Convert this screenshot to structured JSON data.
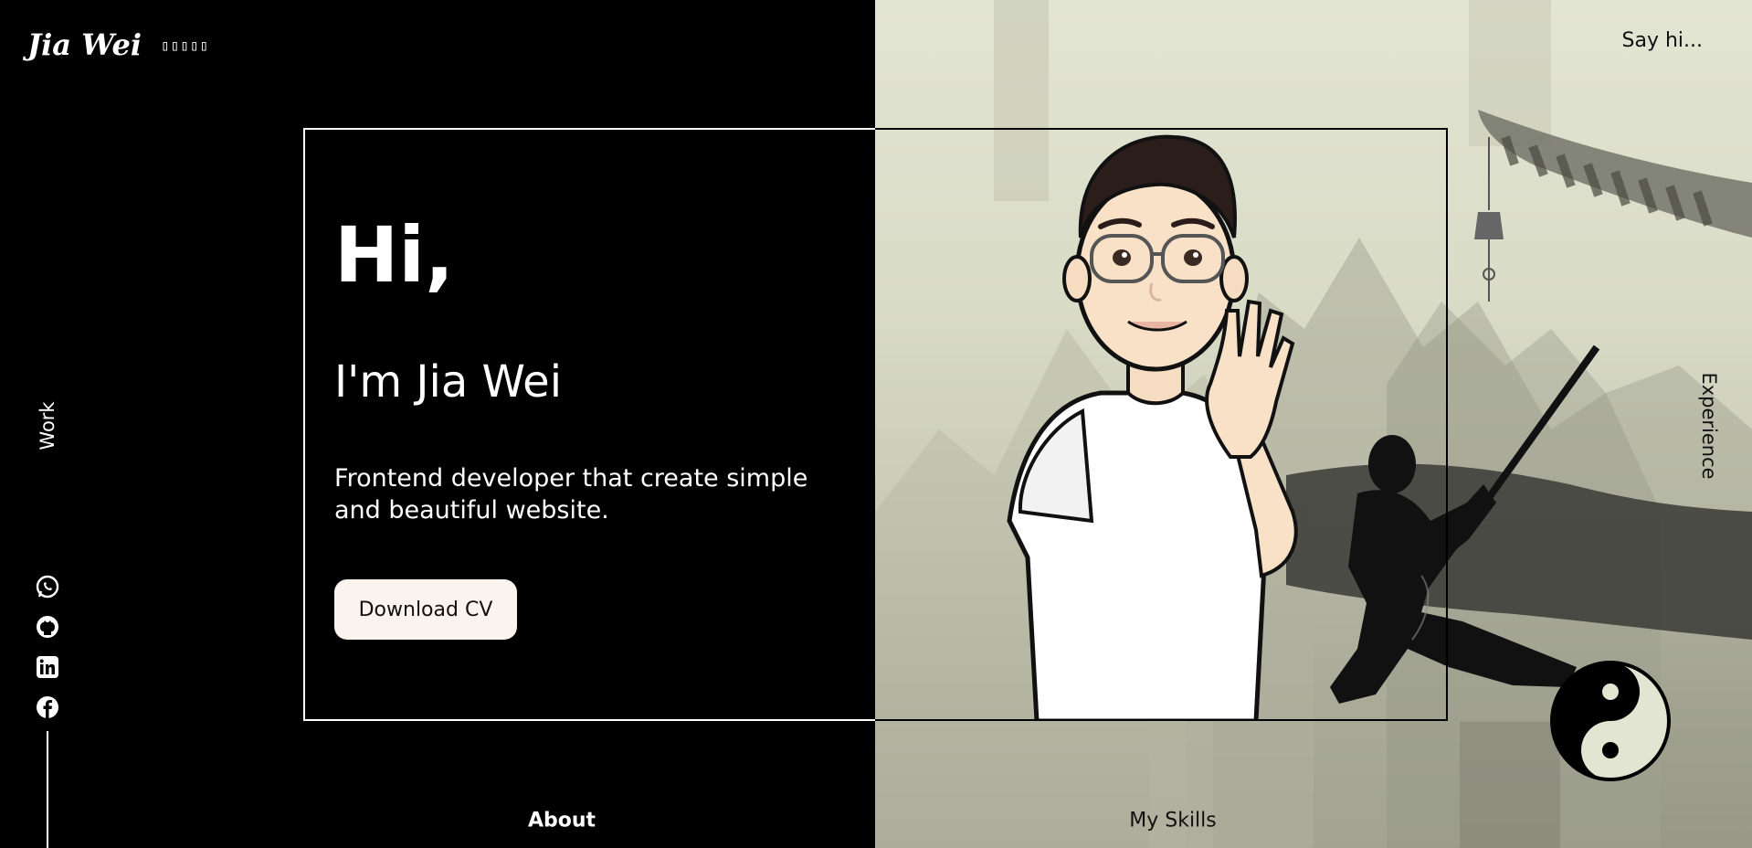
{
  "header": {
    "logo_text": "Jia Wei",
    "logo_glyphs": "▯▯▯▯▯",
    "say_hi": "Say hi..."
  },
  "side_nav": {
    "left_label": "Work",
    "right_label": "Experience"
  },
  "hero": {
    "greeting": "Hi,",
    "intro": "I'm Jia Wei",
    "description": "Frontend developer that create simple and beautiful website.",
    "cta_label": "Download CV"
  },
  "bottom_nav": {
    "left_label": "About",
    "right_label": "My Skills"
  },
  "socials": [
    "whatsapp-icon",
    "github-icon",
    "linkedin-icon",
    "facebook-icon"
  ],
  "colors": {
    "left_bg": "#000000",
    "right_bg": "#e2e5d2",
    "button_bg": "#fbf3ee"
  }
}
